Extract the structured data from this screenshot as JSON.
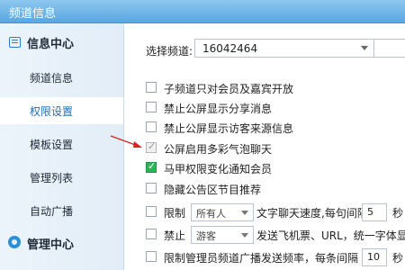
{
  "window": {
    "title": "频道信息"
  },
  "sidebar": {
    "sections": [
      {
        "label": "信息中心",
        "icon": "list-icon"
      },
      {
        "label": "管理中心",
        "icon": "gear-icon"
      }
    ],
    "items": [
      {
        "label": "频道信息"
      },
      {
        "label": "权限设置",
        "active": true
      },
      {
        "label": "模板设置"
      },
      {
        "label": "管理列表"
      },
      {
        "label": "自动广播"
      }
    ]
  },
  "main": {
    "channel_label": "选择频道:",
    "channel_value": "16042464",
    "options": [
      {
        "label": "子频道只对会员及嘉宾开放",
        "checked": false
      },
      {
        "label": "禁止公屏显示分享消息",
        "checked": false
      },
      {
        "label": "禁止公屏显示访客来源信息",
        "checked": false
      },
      {
        "label": "公屏启用多彩气泡聊天",
        "checked": "greyed"
      },
      {
        "label": "马甲权限变化通知会员",
        "checked": true
      },
      {
        "label": "隐藏公告区节目推荐",
        "checked": false
      }
    ],
    "limit_row": {
      "label": "限制",
      "select_value": "所有人",
      "text": "文字聊天速度,每句间隔",
      "number": "5",
      "unit": "秒"
    },
    "ban_row": {
      "label": "禁止",
      "select_value": "游客",
      "text": "发送飞机票、URL，统一字体显"
    },
    "admin_row": {
      "label": "限制管理员频道广播发送频率，每条间隔",
      "number": "10",
      "unit": "秒"
    }
  },
  "colors": {
    "titlebar": "#5aa7e2",
    "accent": "#1f6fb8",
    "check_on": "#2bb45a",
    "annotation": "#e02020"
  }
}
